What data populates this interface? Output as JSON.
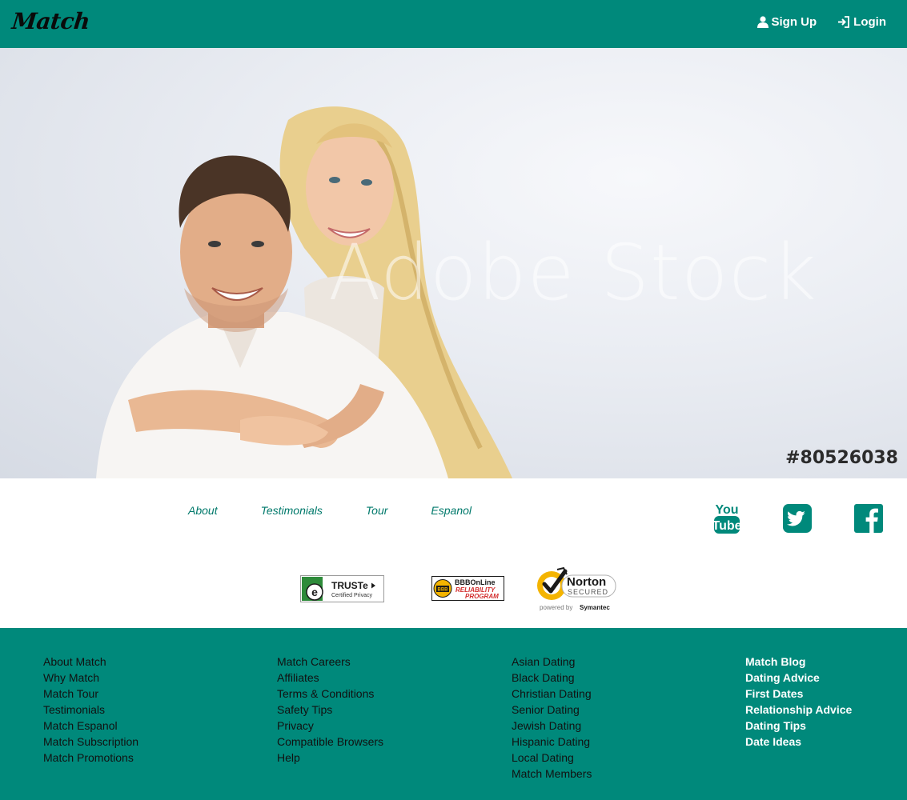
{
  "header": {
    "logo": "Match",
    "signup_label": "Sign Up",
    "login_label": "Login"
  },
  "hero": {
    "watermark": "Adobe Stock",
    "stock_id": "#80526038"
  },
  "subnav": [
    "About",
    "Testimonials",
    "Tour",
    "Espanol"
  ],
  "social": [
    "youtube-icon",
    "twitter-icon",
    "facebook-icon"
  ],
  "badges": {
    "truste": {
      "title": "TRUSTe",
      "subtitle": "Certified Privacy"
    },
    "bbb": {
      "line1": "BBBOnLine",
      "line2": "RELIABILITY",
      "line3": "PROGRAM"
    },
    "norton": {
      "title": "Norton",
      "subtitle": "SECURED",
      "powered_prefix": "powered by",
      "powered_brand": "Symantec"
    }
  },
  "footer": {
    "col1": [
      "About Match",
      "Why Match",
      "Match Tour",
      "Testimonials",
      "Match Espanol",
      "Match Subscription",
      "Match Promotions"
    ],
    "col2": [
      "Match Careers",
      "Affiliates",
      "Terms & Conditions",
      "Safety Tips",
      "Privacy",
      "Compatible Browsers",
      "Help"
    ],
    "col3": [
      "Asian Dating",
      "Black Dating",
      "Christian Dating",
      "Senior Dating",
      "Jewish Dating",
      "Hispanic Dating",
      "Local Dating",
      "Match Members"
    ],
    "col4": [
      "Match Blog",
      "Dating Advice",
      "First Dates",
      "Relationship Advice",
      "Dating Tips",
      "Date Ideas"
    ]
  },
  "colors": {
    "brand": "#00897b",
    "link": "#00796b"
  }
}
